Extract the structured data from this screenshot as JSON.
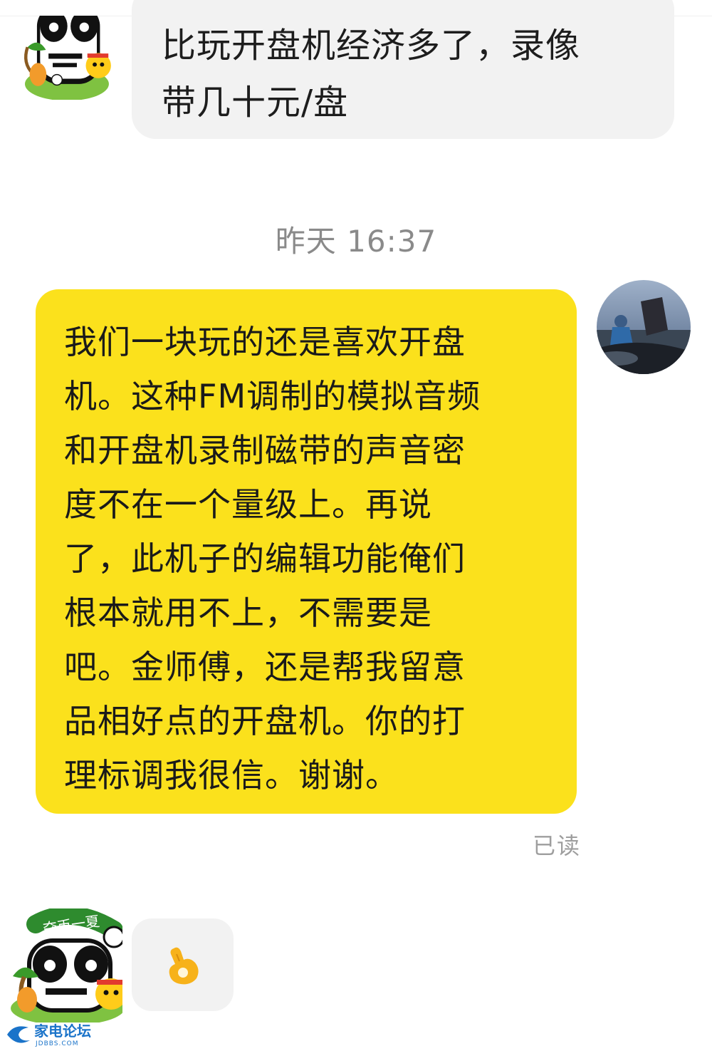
{
  "messages": {
    "incoming_1": {
      "lines": [
        "比玩开盘机经济多了，录像",
        "带几十元/盘"
      ]
    },
    "timestamp": "昨天 16:37",
    "outgoing": {
      "lines": [
        "我们一块玩的还是喜欢开盘",
        "机。这种FM调制的模拟音频",
        "和开盘机录制磁带的声音密",
        "度不在一个量级上。再说",
        "了，此机子的编辑功能俺们",
        "根本就用不上，不需要是",
        "吧。金师傅，还是帮我留意",
        "品相好点的开盘机。你的打",
        "理标调我很信。谢谢。"
      ],
      "read_status": "已读"
    },
    "incoming_2": {
      "emoji": "ok-hand-emoji"
    }
  },
  "avatar_badge_text": "夺币一夏",
  "watermark": {
    "name": "家电论坛",
    "domain": "JDBBS.COM"
  },
  "colors": {
    "outgoing_bubble": "#fbe11c",
    "incoming_bubble": "#f2f2f2",
    "timestamp_text": "#8a8a8a",
    "read_text": "#9e9e9e"
  }
}
